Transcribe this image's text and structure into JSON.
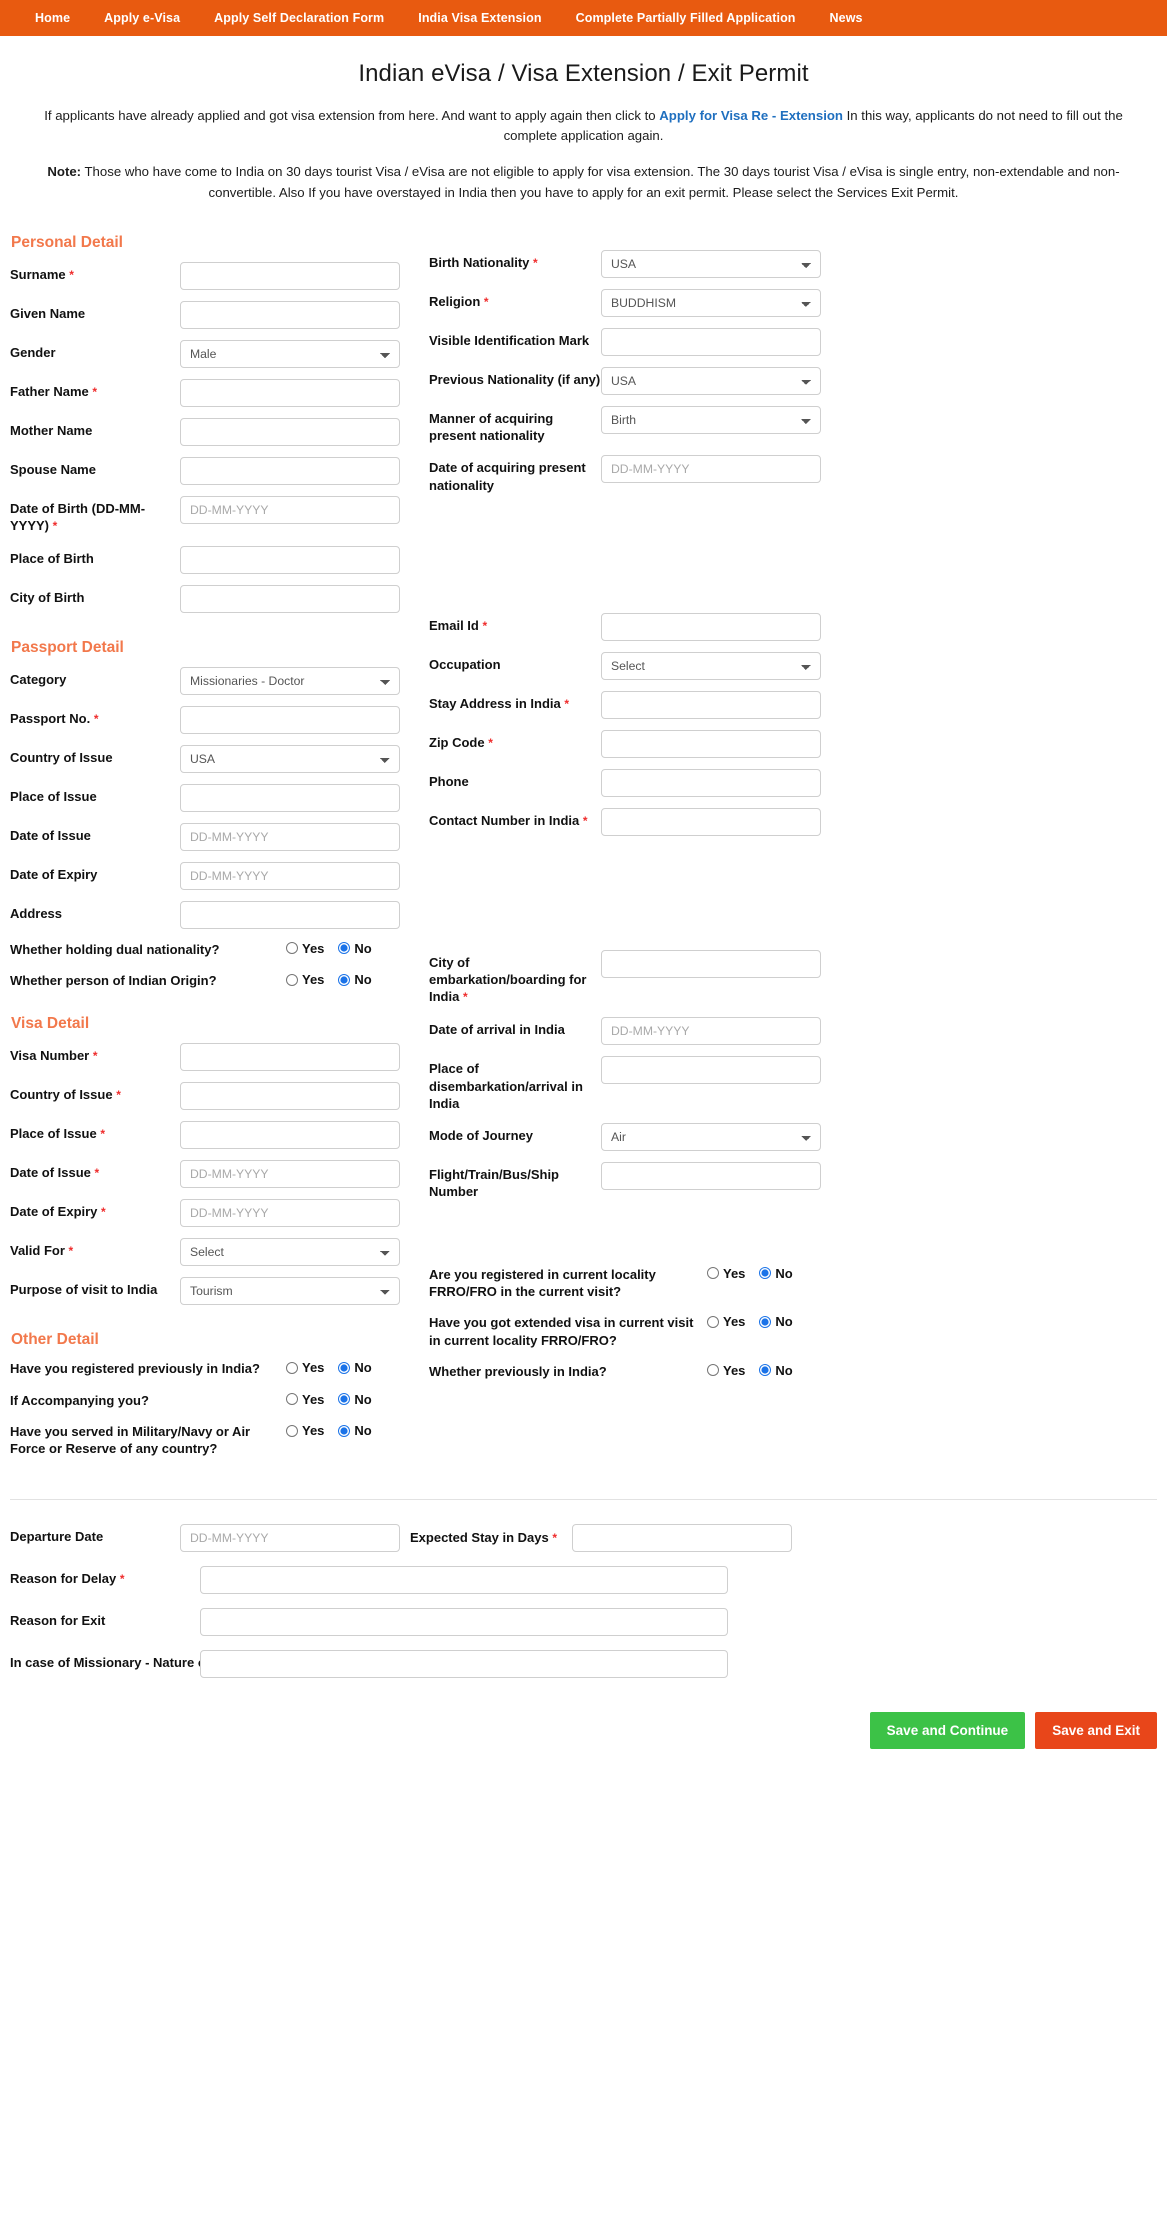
{
  "nav": {
    "items": [
      {
        "label": "Home",
        "name": "nav-home"
      },
      {
        "label": "Apply e-Visa",
        "name": "nav-apply-evisa"
      },
      {
        "label": "Apply Self Declaration Form",
        "name": "nav-apply-self-declaration"
      },
      {
        "label": "India Visa Extension",
        "name": "nav-india-visa-extension"
      },
      {
        "label": "Complete Partially Filled Application",
        "name": "nav-complete-partially-filled"
      },
      {
        "label": "News",
        "name": "nav-news"
      }
    ],
    "bar_color": "#e85a10"
  },
  "header": {
    "title": "Indian eVisa / Visa Extension / Exit Permit",
    "intro_before": "If applicants have already applied and got visa extension from here. And want to apply again then click to ",
    "intro_link": "Apply for Visa Re - Extension",
    "intro_after": " In this way, applicants do not need to fill out the complete application again.",
    "note_label": "Note:",
    "note_text": " Those who have come to India on 30 days tourist Visa / eVisa are not eligible to apply for visa extension. The 30 days tourist Visa / eVisa is single entry, non-extendable and non-convertible. Also If you have overstayed in India then you have to apply for an exit permit. Please select the Services Exit Permit.",
    "link_color": "#1f6fbf"
  },
  "placeholders": {
    "date": "DD-MM-YYYY",
    "empty": ""
  },
  "sections": {
    "personal": {
      "heading": "Personal Detail",
      "left": [
        {
          "label": "Surname",
          "required": true,
          "type": "text",
          "value": ""
        },
        {
          "label": "Given Name",
          "required": false,
          "type": "text",
          "value": ""
        },
        {
          "label": "Gender",
          "required": false,
          "type": "select",
          "value": "Male"
        },
        {
          "label": "Father Name",
          "required": true,
          "type": "text",
          "value": ""
        },
        {
          "label": "Mother Name",
          "required": false,
          "type": "text",
          "value": ""
        },
        {
          "label": "Spouse Name",
          "required": false,
          "type": "text",
          "value": ""
        },
        {
          "label": "Date of Birth (DD-MM-YYYY)",
          "required": true,
          "type": "date",
          "value": ""
        },
        {
          "label": "Place of Birth",
          "required": false,
          "type": "text",
          "value": ""
        },
        {
          "label": "City of Birth",
          "required": false,
          "type": "text",
          "value": ""
        }
      ],
      "right": [
        {
          "label": "Birth Nationality",
          "required": true,
          "type": "select",
          "value": "USA"
        },
        {
          "label": "Religion",
          "required": true,
          "type": "select",
          "value": "BUDDHISM"
        },
        {
          "label": "Visible Identification Mark",
          "required": false,
          "type": "text",
          "value": ""
        },
        {
          "label": "Previous Nationality (if any)",
          "required": false,
          "type": "select",
          "value": "USA"
        },
        {
          "label": "Manner of acquiring present nationality",
          "required": false,
          "type": "select",
          "value": "Birth"
        },
        {
          "label": "Date of acquiring present nationality",
          "required": false,
          "type": "date",
          "value": ""
        }
      ]
    },
    "passport": {
      "heading": "Passport Detail",
      "left": [
        {
          "label": "Category",
          "required": false,
          "type": "select",
          "value": "Missionaries - Doctor"
        },
        {
          "label": "Passport No.",
          "required": true,
          "type": "text",
          "value": ""
        },
        {
          "label": "Country of Issue",
          "required": false,
          "type": "select",
          "value": "USA"
        },
        {
          "label": "Place of Issue",
          "required": false,
          "type": "text",
          "value": ""
        },
        {
          "label": "Date of Issue",
          "required": false,
          "type": "date",
          "value": ""
        },
        {
          "label": "Date of Expiry",
          "required": false,
          "type": "date",
          "value": ""
        },
        {
          "label": "Address",
          "required": false,
          "type": "text",
          "value": ""
        }
      ],
      "left_radios": [
        {
          "label": "Whether holding dual nationality?",
          "yes": "Yes",
          "no": "No",
          "selected": "No"
        },
        {
          "label": "Whether person of Indian Origin?",
          "yes": "Yes",
          "no": "No",
          "selected": "No"
        }
      ],
      "right": [
        {
          "label": "Email Id",
          "required": true,
          "type": "text",
          "value": ""
        },
        {
          "label": "Occupation",
          "required": false,
          "type": "select",
          "value": "Select"
        },
        {
          "label": "Stay Address in India",
          "required": true,
          "type": "text",
          "value": ""
        },
        {
          "label": "Zip Code",
          "required": true,
          "type": "text",
          "value": ""
        },
        {
          "label": "Phone",
          "required": false,
          "type": "text",
          "value": ""
        },
        {
          "label": "Contact Number in India",
          "required": true,
          "type": "text",
          "value": ""
        }
      ]
    },
    "visa": {
      "heading": "Visa Detail",
      "left": [
        {
          "label": "Visa Number",
          "required": true,
          "type": "text",
          "value": ""
        },
        {
          "label": "Country of Issue",
          "required": true,
          "type": "text",
          "value": ""
        },
        {
          "label": "Place of Issue",
          "required": true,
          "type": "text",
          "value": ""
        },
        {
          "label": "Date of Issue",
          "required": true,
          "type": "date",
          "value": ""
        },
        {
          "label": "Date of Expiry",
          "required": true,
          "type": "date",
          "value": ""
        },
        {
          "label": "Valid For",
          "required": true,
          "type": "select",
          "value": "Select"
        },
        {
          "label": "Purpose of visit to India",
          "required": false,
          "type": "select",
          "value": "Tourism"
        }
      ],
      "right": [
        {
          "label": "City of embarkation/boarding for India",
          "required": true,
          "type": "text",
          "value": ""
        },
        {
          "label": "Date of arrival in India",
          "required": false,
          "type": "date",
          "value": ""
        },
        {
          "label": "Place of disembarkation/arrival in India",
          "required": false,
          "type": "text",
          "value": ""
        },
        {
          "label": "Mode of Journey",
          "required": false,
          "type": "select",
          "value": "Air"
        },
        {
          "label": "Flight/Train/Bus/Ship Number",
          "required": false,
          "type": "text",
          "value": ""
        }
      ]
    },
    "other": {
      "heading": "Other Detail",
      "left_radios": [
        {
          "label": "Have you registered previously in India?",
          "yes": "Yes",
          "no": "No",
          "selected": "No"
        },
        {
          "label": "If Accompanying you?",
          "yes": "Yes",
          "no": "No",
          "selected": "No"
        },
        {
          "label": "Have you served in Military/Navy or Air Force or Reserve of any country?",
          "yes": "Yes",
          "no": "No",
          "selected": "No"
        }
      ],
      "right_radios": [
        {
          "label": "Are you registered in current locality FRRO/FRO in the current visit?",
          "yes": "Yes",
          "no": "No",
          "selected": "No"
        },
        {
          "label": "Have you got extended visa in current visit in current locality FRRO/FRO?",
          "yes": "Yes",
          "no": "No",
          "selected": "No"
        },
        {
          "label": "Whether previously in India?",
          "yes": "Yes",
          "no": "No",
          "selected": "No"
        }
      ]
    }
  },
  "bottom": {
    "departure_label": "Departure Date",
    "departure_value": "",
    "expected_stay_label": "Expected Stay in Days",
    "expected_stay_value": "",
    "reason_delay_label": "Reason for Delay",
    "reason_delay_value": "",
    "reason_exit_label": "Reason for Exit",
    "reason_exit_value": "",
    "missionary_label": "In case of Missionary - Nature of work",
    "missionary_value": ""
  },
  "actions": {
    "save_continue": "Save and Continue",
    "save_exit": "Save and Exit",
    "green": "#3cc247",
    "orange": "#e8461a"
  }
}
